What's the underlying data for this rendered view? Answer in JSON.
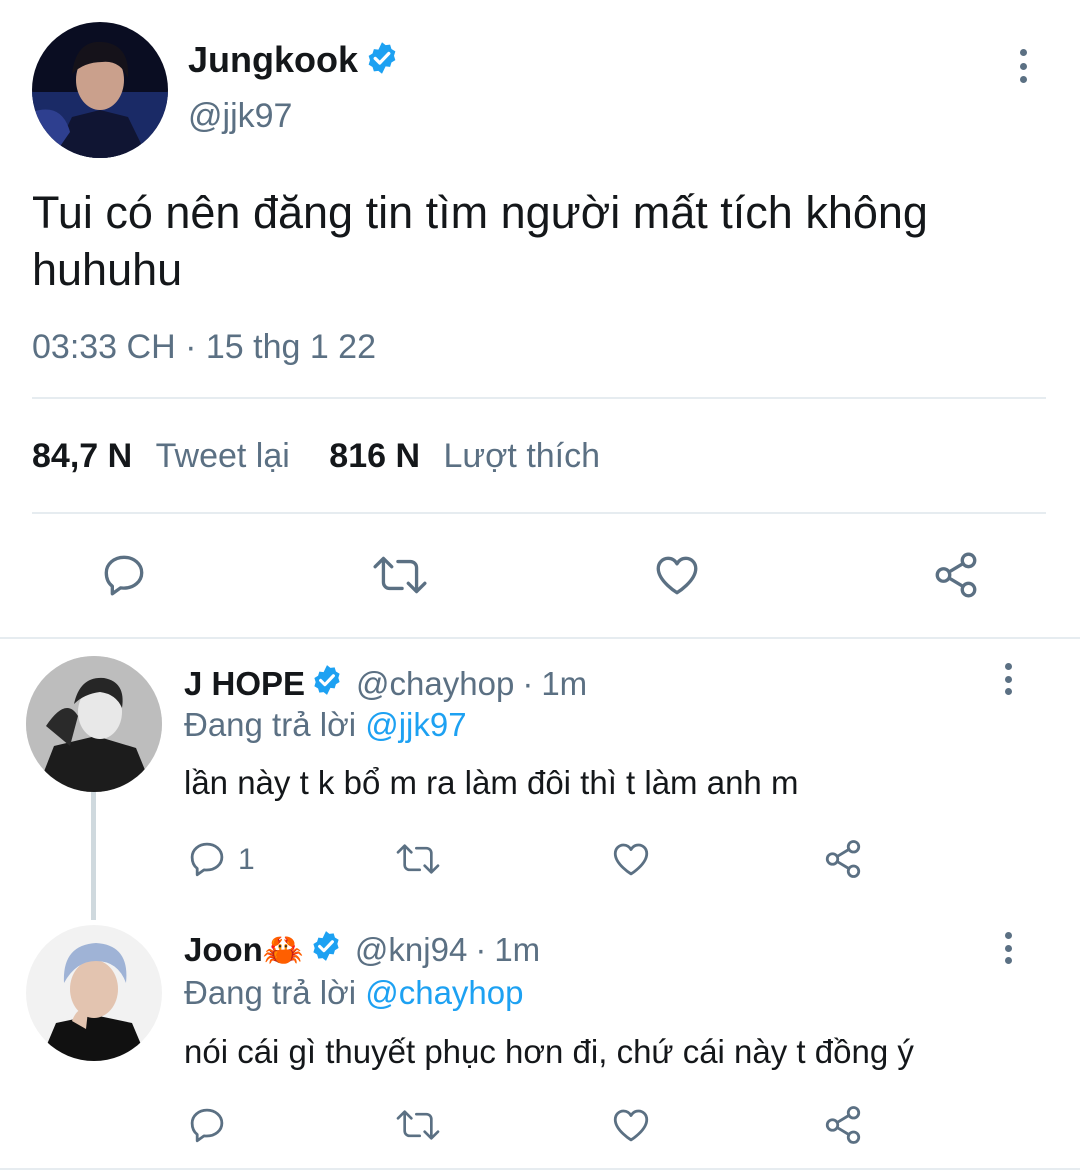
{
  "main_tweet": {
    "author_name": "Jungkook",
    "handle": "@jjk97",
    "text_line1": "Tui có nên đăng tin tìm người mất tích không",
    "text_line2": "huhuhu",
    "timestamp": "03:33 CH · 15 thg 1 22",
    "retweet_count": "84,7 N",
    "retweet_label": "Tweet lại",
    "like_count": "816 N",
    "like_label": "Lượt thích",
    "verified": true
  },
  "replies": [
    {
      "author_name": "J HOPE",
      "handle": "@chayhop",
      "time": "1m",
      "replying_prefix": "Đang trả lời",
      "replying_to": "@jjk97",
      "text": "lần này t k bổ m ra làm đôi thì t làm anh m",
      "reply_count": "1",
      "verified": true
    },
    {
      "author_name": "Joon🦀",
      "handle": "@knj94",
      "time": "1m",
      "replying_prefix": "Đang trả lời",
      "replying_to": "@chayhop",
      "text": "nói cái gì thuyết phục hơn đi, chứ cái này t đồng ý",
      "reply_count": "",
      "verified": true
    }
  ],
  "colors": {
    "accent": "#1da1f2",
    "secondary_text": "#5b7083",
    "primary_text": "#14171a",
    "divider": "#e6ecf0"
  },
  "icons": [
    "more-icon",
    "verified-icon",
    "reply-icon",
    "retweet-icon",
    "like-icon",
    "share-icon"
  ]
}
